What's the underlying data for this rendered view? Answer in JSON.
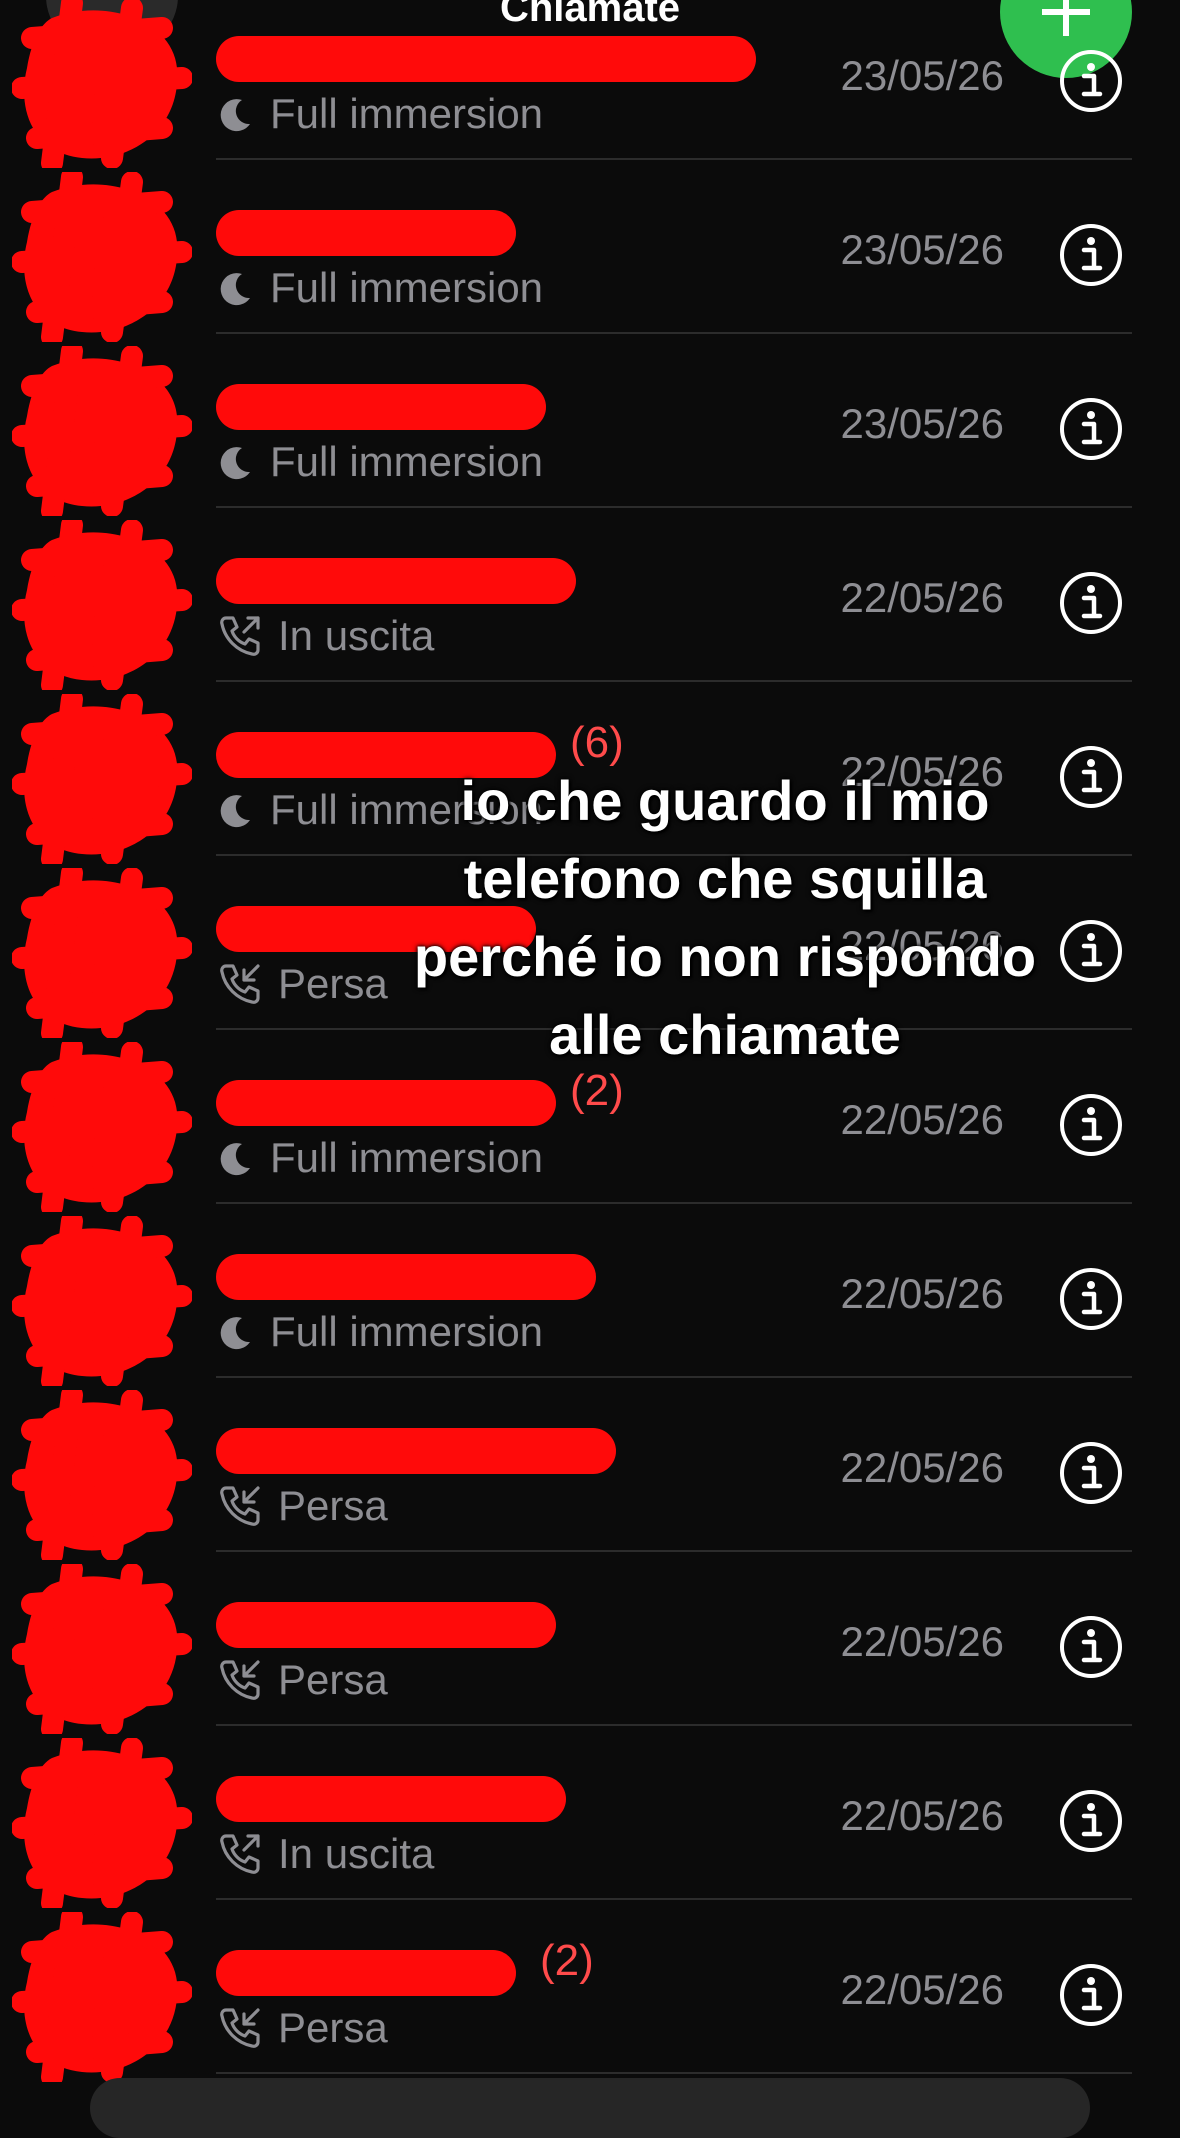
{
  "header": {
    "title": "Chiamate"
  },
  "calls": [
    {
      "status": "Full immersion",
      "status_icon": "moon-icon",
      "date": "23/05/26",
      "count": ""
    },
    {
      "status": "Full immersion",
      "status_icon": "moon-icon",
      "date": "23/05/26",
      "count": ""
    },
    {
      "status": "Full immersion",
      "status_icon": "moon-icon",
      "date": "23/05/26",
      "count": ""
    },
    {
      "status": "In uscita",
      "status_icon": "outgoing-call-icon",
      "date": "22/05/26",
      "count": ""
    },
    {
      "status": "Full immersion",
      "status_icon": "moon-icon",
      "date": "22/05/26",
      "count": "(6)"
    },
    {
      "status": "Persa",
      "status_icon": "missed-call-icon",
      "date": "22/05/26",
      "count": ""
    },
    {
      "status": "Full immersion",
      "status_icon": "moon-icon",
      "date": "22/05/26",
      "count": "(2)"
    },
    {
      "status": "Full immersion",
      "status_icon": "moon-icon",
      "date": "22/05/26",
      "count": ""
    },
    {
      "status": "Persa",
      "status_icon": "missed-call-icon",
      "date": "22/05/26",
      "count": ""
    },
    {
      "status": "Persa",
      "status_icon": "missed-call-icon",
      "date": "22/05/26",
      "count": ""
    },
    {
      "status": "In uscita",
      "status_icon": "outgoing-call-icon",
      "date": "22/05/26",
      "count": ""
    },
    {
      "status": "Persa",
      "status_icon": "missed-call-icon",
      "date": "22/05/26",
      "count": "(2)"
    }
  ],
  "overlay": {
    "lines": [
      "io che guardo il mio",
      "telefono che squilla",
      "perché io non rispondo",
      "alle chiamate"
    ]
  },
  "colors": {
    "background": "#0b0b0b",
    "accent_green": "#2fbf4f",
    "redaction": "#ff0a0a",
    "missed_count": "#ff4b4b",
    "secondary_text": "#8e8e93"
  }
}
